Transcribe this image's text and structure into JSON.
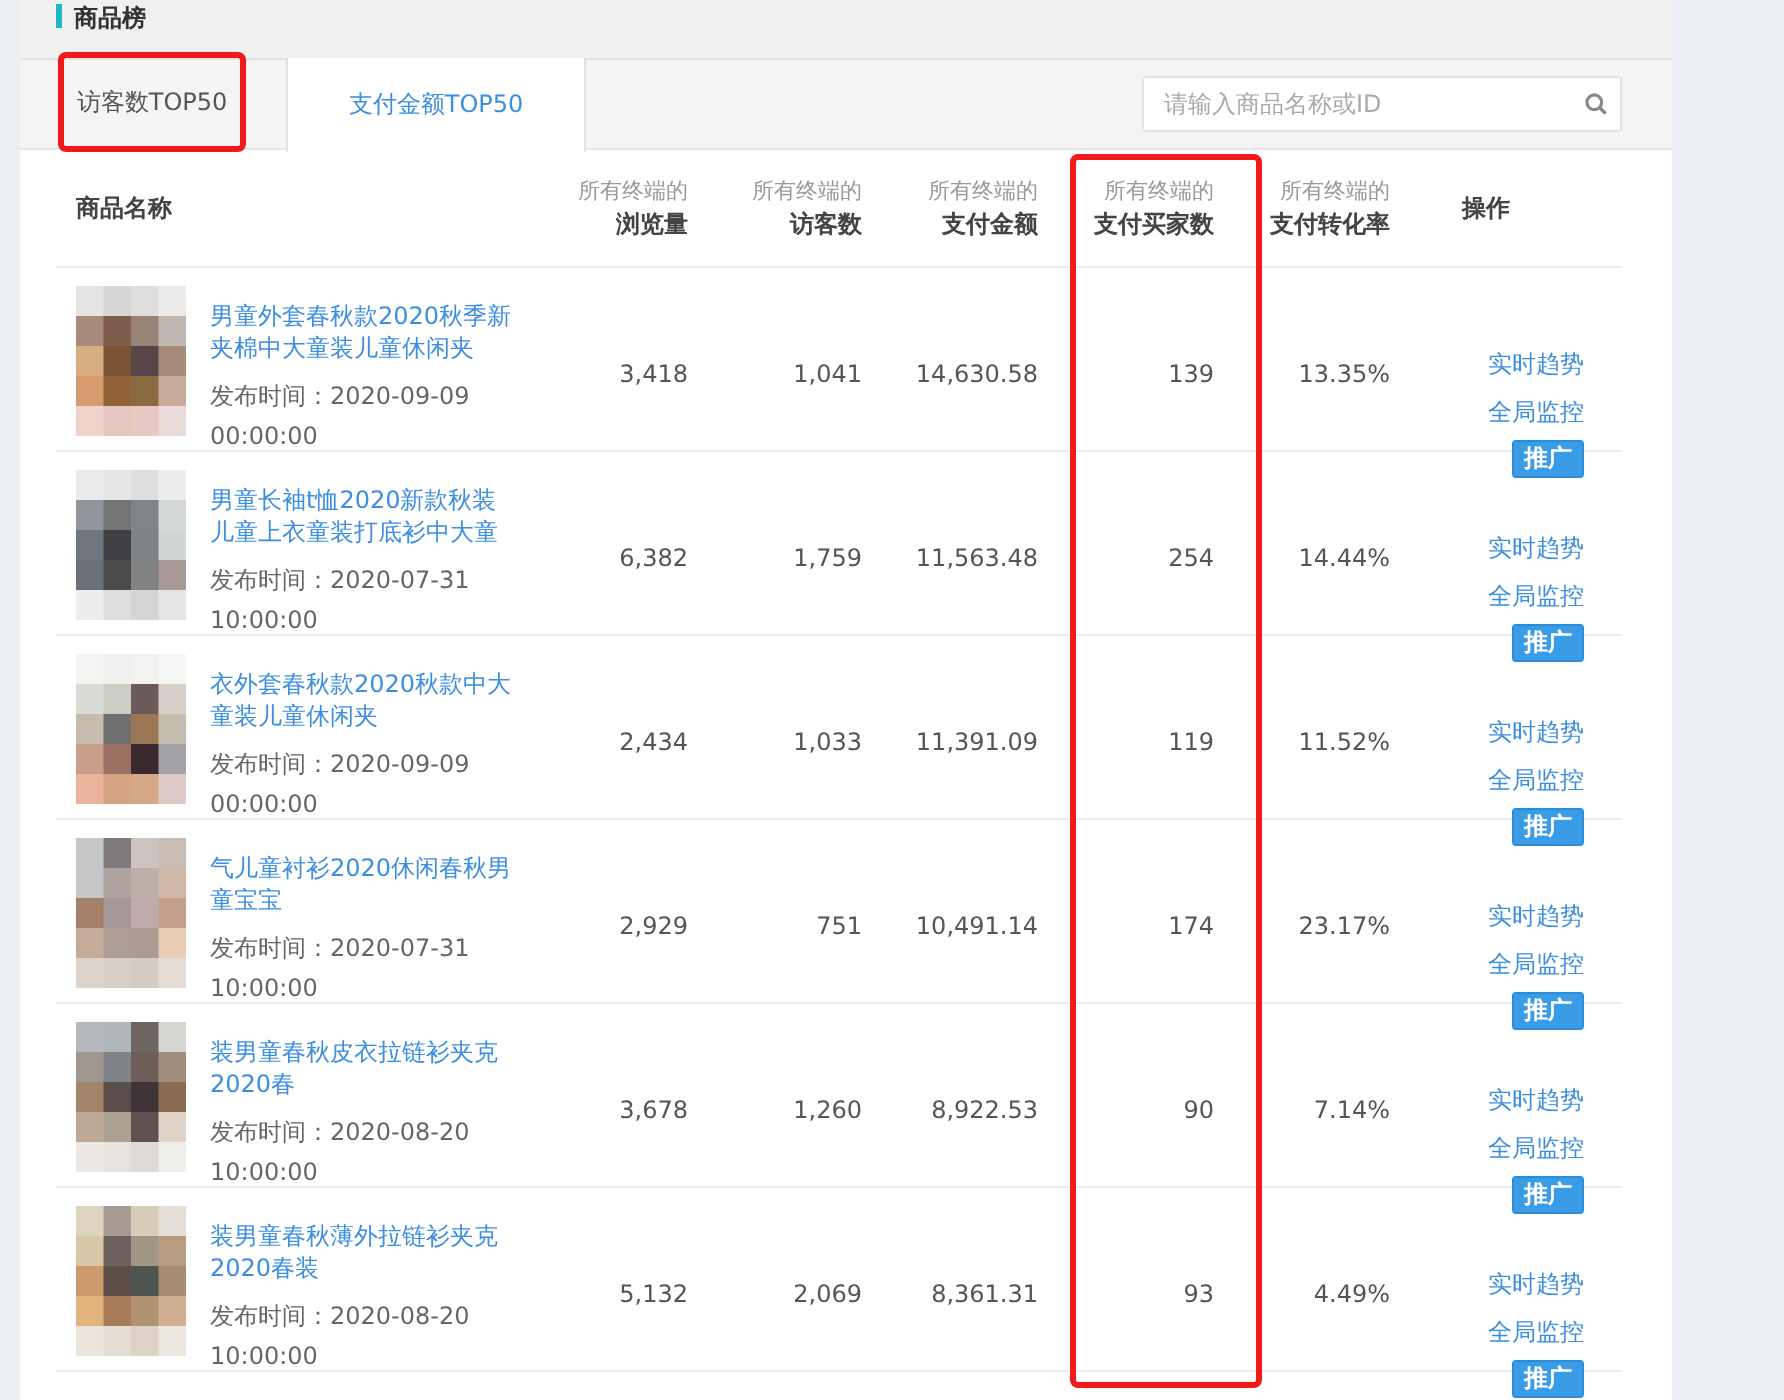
{
  "section_title": "商品榜",
  "tabs": [
    {
      "label": "访客数TOP50",
      "selected": false,
      "highlighted": true
    },
    {
      "label": "支付金额TOP50",
      "selected": true,
      "highlighted": false
    }
  ],
  "search": {
    "placeholder": "请输入商品名称或ID"
  },
  "table": {
    "columns": [
      {
        "label": "商品名称"
      },
      {
        "prefix": "所有终端的",
        "label": "浏览量"
      },
      {
        "prefix": "所有终端的",
        "label": "访客数"
      },
      {
        "prefix": "所有终端的",
        "label": "支付金额"
      },
      {
        "prefix": "所有终端的",
        "label": "支付买家数",
        "highlighted": true
      },
      {
        "prefix": "所有终端的",
        "label": "支付转化率"
      },
      {
        "label": "操作"
      }
    ],
    "rows": [
      {
        "title": "男童外套春秋款2020秋季新夹棉中大童装儿童休闲夹",
        "published": "发布时间：2020-09-09 00:00:00",
        "views": "3,418",
        "visitors": "1,041",
        "amount": "14,630.58",
        "buyers": "139",
        "rate": "13.35%",
        "actions": [
          "实时趋势",
          "全局监控"
        ],
        "button": "推广"
      },
      {
        "title": "男童长袖t恤2020新款秋装儿童上衣童装打底衫中大童",
        "published": "发布时间：2020-07-31 10:00:00",
        "views": "6,382",
        "visitors": "1,759",
        "amount": "11,563.48",
        "buyers": "254",
        "rate": "14.44%",
        "actions": [
          "实时趋势",
          "全局监控"
        ],
        "button": "推广"
      },
      {
        "title": "衣外套春秋款2020秋款中大童装儿童休闲夹",
        "published": "发布时间：2020-09-09 00:00:00",
        "views": "2,434",
        "visitors": "1,033",
        "amount": "11,391.09",
        "buyers": "119",
        "rate": "11.52%",
        "actions": [
          "实时趋势",
          "全局监控"
        ],
        "button": "推广"
      },
      {
        "title": "气儿童衬衫2020休闲春秋男童宝宝",
        "published": "发布时间：2020-07-31 10:00:00",
        "views": "2,929",
        "visitors": "751",
        "amount": "10,491.14",
        "buyers": "174",
        "rate": "23.17%",
        "actions": [
          "实时趋势",
          "全局监控"
        ],
        "button": "推广"
      },
      {
        "title": "装男童春秋皮衣拉链衫夹克2020春",
        "published": "发布时间：2020-08-20 10:00:00",
        "views": "3,678",
        "visitors": "1,260",
        "amount": "8,922.53",
        "buyers": "90",
        "rate": "7.14%",
        "actions": [
          "实时趋势",
          "全局监控"
        ],
        "button": "推广"
      },
      {
        "title": "装男童春秋薄外拉链衫夹克2020春装",
        "published": "发布时间：2020-08-20 10:00:00",
        "views": "5,132",
        "visitors": "2,069",
        "amount": "8,361.31",
        "buyers": "93",
        "rate": "4.49%",
        "actions": [
          "实时趋势",
          "全局监控"
        ],
        "button": "推广"
      }
    ]
  }
}
